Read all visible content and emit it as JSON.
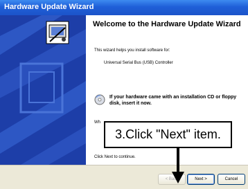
{
  "window": {
    "title": "Hardware Update Wizard"
  },
  "wizard": {
    "heading": "Welcome to the Hardware Update Wizard",
    "intro": "This wizard helps you install software for:",
    "device": "Universal Serial Bus (USB) Controller",
    "cd_hint": "If your hardware came with an installation CD or floppy disk, insert it now.",
    "question_partial": "Wh",
    "continue_text": "Click Next to continue."
  },
  "buttons": {
    "back": "< Back",
    "next": "Next >",
    "cancel": "Cancel"
  },
  "annotation": {
    "callout": "3.Click \"Next\" item."
  },
  "icons": {
    "wizard_graphic": "hardware-wizard-icon",
    "cd": "cd-icon",
    "arrow": "arrow-down-icon"
  },
  "colors": {
    "titlebar": "#1f5fd8",
    "banner": "#1d3ea8",
    "dialog": "#ece9d8"
  }
}
